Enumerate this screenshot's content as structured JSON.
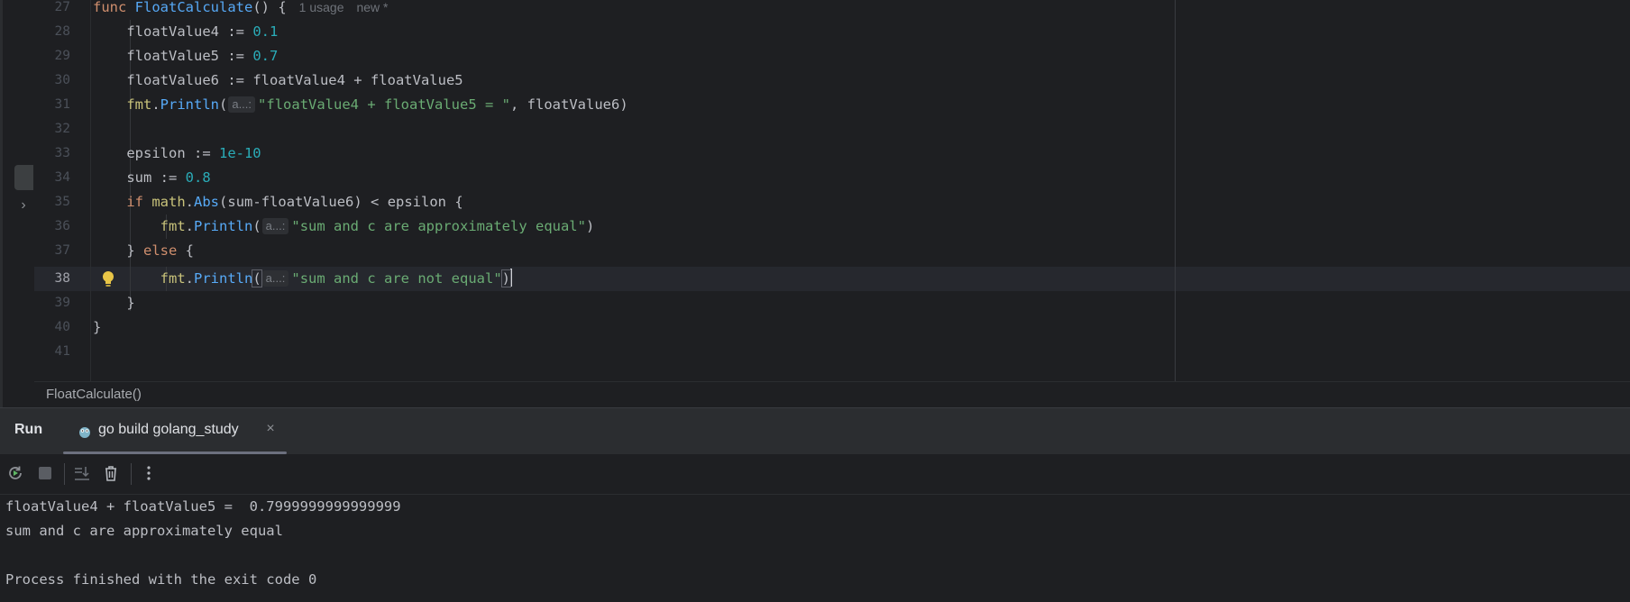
{
  "editor": {
    "line_numbers": [
      "27",
      "28",
      "29",
      "30",
      "31",
      "32",
      "33",
      "34",
      "35",
      "36",
      "37",
      "38",
      "39",
      "40",
      "41"
    ],
    "func_meta": {
      "usages": "1 usage",
      "new": "new *"
    },
    "param_hint": "a...:",
    "tokens": {
      "func": "func",
      "func_name": "FloatCalculate",
      "v4": "floatValue4",
      "v5": "floatValue5",
      "v6": "floatValue6",
      "n01": "0.1",
      "n07": "0.7",
      "fmt": "fmt",
      "println": "Println",
      "s1": "\"floatValue4 + floatValue5 = \"",
      "epsilon": "epsilon",
      "eps_val": "1e-10",
      "sum": "sum",
      "n08": "0.8",
      "if": "if",
      "math": "math",
      "abs": "Abs",
      "s2": "\"sum and c are approximately equal\"",
      "else": "else",
      "s3": "\"sum and c are not equal\""
    }
  },
  "breadcrumb": "FloatCalculate()",
  "run": {
    "title": "Run",
    "tab_label": "go build golang_study",
    "tab_close": "×",
    "output": [
      "floatValue4 + floatValue5 =  0.7999999999999999",
      "sum and c are approximately equal",
      "",
      "Process finished with the exit code 0"
    ]
  },
  "colors": {
    "keyword": "#cf8e6d",
    "function": "#56a8f5",
    "number": "#2aacb8",
    "string": "#6aab73",
    "background": "#1e1f22"
  }
}
